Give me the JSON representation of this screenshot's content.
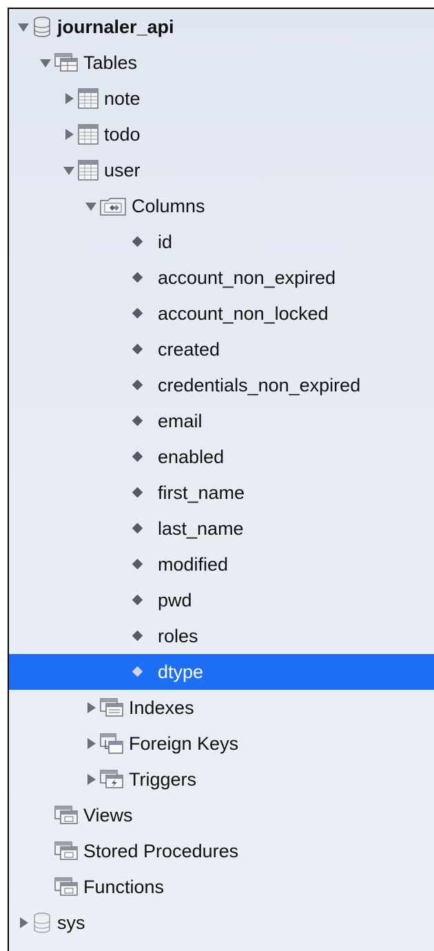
{
  "tree": {
    "schema_journaler": {
      "label": "journaler_api"
    },
    "tables_folder": {
      "label": "Tables"
    },
    "table_note": {
      "label": "note"
    },
    "table_todo": {
      "label": "todo"
    },
    "table_user": {
      "label": "user"
    },
    "columns_folder": {
      "label": "Columns"
    },
    "columns": [
      "id",
      "account_non_expired",
      "account_non_locked",
      "created",
      "credentials_non_expired",
      "email",
      "enabled",
      "first_name",
      "last_name",
      "modified",
      "pwd",
      "roles",
      "dtype"
    ],
    "selected_column": "dtype",
    "indexes_folder": {
      "label": "Indexes"
    },
    "foreign_keys_folder": {
      "label": "Foreign Keys"
    },
    "triggers_folder": {
      "label": "Triggers"
    },
    "views_folder": {
      "label": "Views"
    },
    "procedures_folder": {
      "label": "Stored Procedures"
    },
    "functions_folder": {
      "label": "Functions"
    },
    "schema_sys": {
      "label": "sys"
    }
  },
  "colors": {
    "selection": "#1e6ff5",
    "background": "#e4e9f2"
  }
}
